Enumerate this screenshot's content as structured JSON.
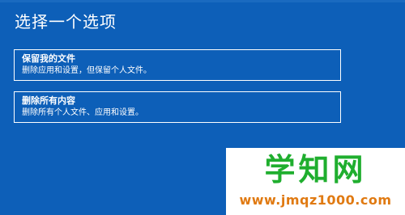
{
  "screen": {
    "title": "选择一个选项",
    "background_color": "#0d5fb8",
    "border_color": "#ffffff"
  },
  "options": [
    {
      "title": "保留我的文件",
      "description": "删除应用和设置，但保留个人文件。"
    },
    {
      "title": "删除所有内容",
      "description": "删除所有个人文件、应用和设置。"
    }
  ],
  "watermark": {
    "logo_text": "学知网",
    "url_text": "www.jmqz1000.com",
    "logo_color": "#1fae2e",
    "url_color": "#e07a12"
  }
}
